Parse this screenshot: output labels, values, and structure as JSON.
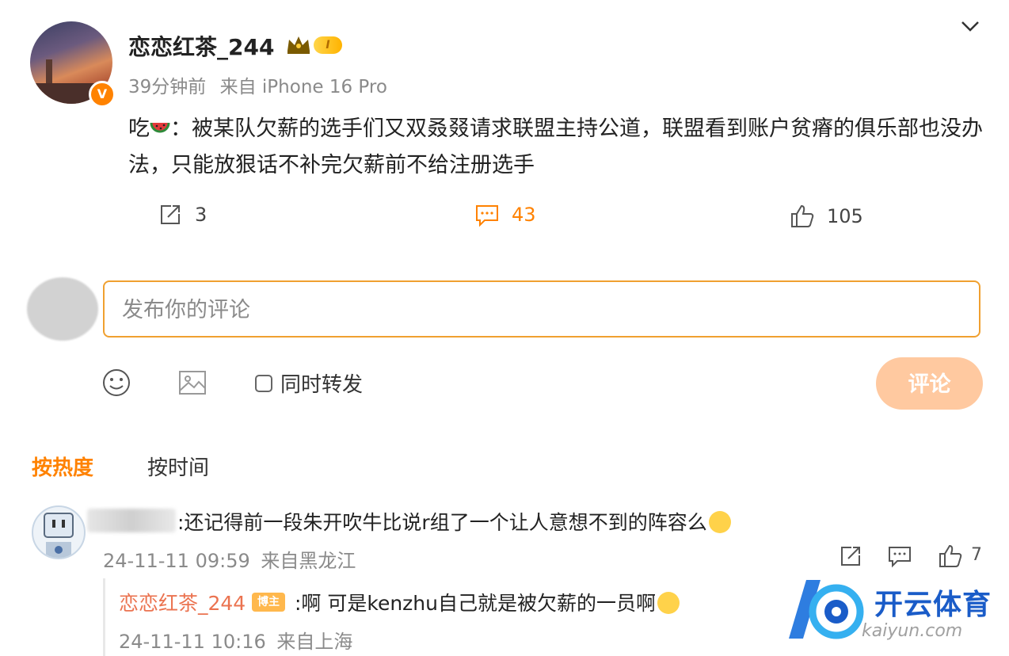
{
  "post": {
    "username": "恋恋红茶_244",
    "level_badge": "I",
    "verified_mark": "V",
    "time": "39分钟前",
    "source": "来自 iPhone 16 Pro",
    "text_prefix": "吃",
    "text_body": "：被某队欠薪的选手们又双叒叕请求联盟主持公道，联盟看到账户贫瘠的俱乐部也没办法，只能放狠话不补完欠薪前不给注册选手",
    "reposts": "3",
    "comments": "43",
    "likes": "105"
  },
  "composer": {
    "placeholder": "发布你的评论",
    "value": "",
    "repost_label": "同时转发",
    "submit_label": "评论"
  },
  "sort": {
    "hot_label": "按热度",
    "time_label": "按时间"
  },
  "comments": [
    {
      "text": ":还记得前一段朱开吹牛比说r组了一个让人意想不到的阵容么",
      "time": "24-11-11 09:59",
      "location": "来自黑龙江",
      "likes": "7",
      "reply": {
        "username": "恋恋红茶_244",
        "badge": "博主",
        "text": ":啊 可是kenzhu自己就是被欠薪的一员啊",
        "time": "24-11-11 10:16",
        "location": "来自上海"
      }
    }
  ],
  "watermark": {
    "brand": "开云体育",
    "url": "kaiyun.com"
  },
  "icons": [
    "chevron-down-icon",
    "watermelon-emoji",
    "repost-icon",
    "comment-icon",
    "like-icon",
    "emoji-icon",
    "image-icon",
    "cat-emoji",
    "sad-emoji"
  ],
  "colors": {
    "accent": "#ff8200",
    "input_border": "#f0a030",
    "submit_disabled": "#ffc9a0",
    "reply_name": "#eb7350",
    "watermark_blue": "#1a5cc8"
  }
}
